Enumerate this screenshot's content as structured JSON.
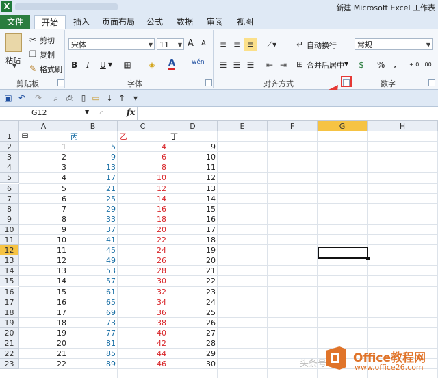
{
  "window": {
    "title": "新建 Microsoft Excel 工作表",
    "app_icon": "X"
  },
  "tabs": [
    "文件",
    "开始",
    "插入",
    "页面布局",
    "公式",
    "数据",
    "审阅",
    "视图"
  ],
  "ribbon": {
    "clipboard": {
      "paste": "粘贴",
      "cut": "剪切",
      "copy": "复制",
      "format_painter": "格式刷",
      "label": "剪贴板"
    },
    "font": {
      "name": "宋体",
      "size": "11",
      "grow": "A",
      "shrink": "A",
      "bold": "B",
      "italic": "I",
      "underline": "U",
      "font_color_letter": "A",
      "phonetic": "wén",
      "label": "字体"
    },
    "alignment": {
      "wrap_text": "自动换行",
      "merge_center": "合并后居中",
      "label": "对齐方式"
    },
    "number": {
      "format": "常规",
      "percent": "%",
      "comma": ",",
      "inc_decimal": "+.0",
      "dec_decimal": ".00",
      "label": "数字"
    }
  },
  "formula_bar": {
    "name_box": "G12",
    "fx": "fx",
    "formula": ""
  },
  "columns": [
    "A",
    "B",
    "C",
    "D",
    "E",
    "F",
    "G",
    "H"
  ],
  "rows": [
    1,
    2,
    3,
    4,
    5,
    6,
    7,
    8,
    9,
    10,
    11,
    12,
    13,
    14,
    15,
    16,
    17,
    18,
    19,
    20,
    21,
    22,
    23
  ],
  "headers": {
    "A": "甲",
    "B": "丙",
    "C": "乙",
    "D": "丁"
  },
  "data": {
    "A": [
      1,
      2,
      3,
      4,
      5,
      6,
      7,
      8,
      9,
      10,
      11,
      12,
      13,
      14,
      15,
      16,
      17,
      18,
      19,
      20,
      21,
      22
    ],
    "B": [
      5,
      9,
      13,
      17,
      21,
      25,
      29,
      33,
      37,
      41,
      45,
      49,
      53,
      57,
      61,
      65,
      69,
      73,
      77,
      81,
      85,
      89
    ],
    "C": [
      4,
      6,
      8,
      10,
      12,
      14,
      16,
      18,
      20,
      22,
      24,
      26,
      28,
      30,
      32,
      34,
      36,
      38,
      40,
      42,
      44,
      46
    ],
    "D": [
      9,
      10,
      11,
      12,
      13,
      14,
      15,
      16,
      17,
      18,
      19,
      20,
      21,
      22,
      23,
      24,
      25,
      26,
      27,
      28,
      29,
      30
    ]
  },
  "colors": {
    "col_b": "#1a6fa5",
    "col_c": "#d8262a",
    "arrow": "#e53935",
    "selected_header": "#f6c343"
  },
  "selected_cell": "G12",
  "watermark": {
    "text": "Office教程网",
    "url": "www.office26.com",
    "faint": "头条号"
  }
}
